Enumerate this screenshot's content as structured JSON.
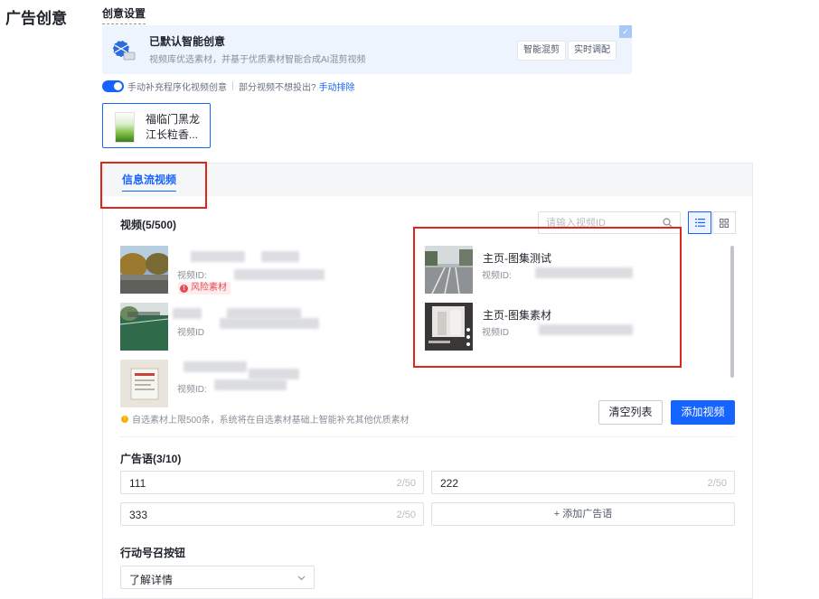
{
  "page": {
    "title": "广告创意",
    "section_title": "创意设置"
  },
  "smart_creative": {
    "title": "已默认智能创意",
    "description": "视频库优选素材，并基于优质素材智能合成AI混剪视频",
    "tags": [
      "智能混剪",
      "实时调配"
    ],
    "check": "✓"
  },
  "toggle_row": {
    "label": "手动补充程序化视频创意",
    "question": "部分视频不想投出?",
    "link": "手动排除"
  },
  "product": {
    "name": "福临门黑龙江长粒香..."
  },
  "tabs": [
    {
      "label": "信息流视频",
      "active": true
    }
  ],
  "videos": {
    "label": "视频(5/500)",
    "search_placeholder": "请输入视频ID",
    "id_prefix_with_colon": "视频ID:",
    "id_prefix_no_colon": "视频ID",
    "risk_label": "风险素材",
    "risk_icon": "!",
    "right_items": [
      {
        "title": "主页-图集测试"
      },
      {
        "title": "主页-图集素材"
      }
    ],
    "tip": "自选素材上限500条，系统将在自选素材基础上智能补充其他优质素材",
    "tip_icon": "!",
    "clear_button": "清空列表",
    "add_button": "添加视频"
  },
  "slogans": {
    "label": "广告语(3/10)",
    "items": [
      {
        "text": "111",
        "count": "2/50"
      },
      {
        "text": "222",
        "count": "2/50"
      },
      {
        "text": "333",
        "count": "2/50"
      }
    ],
    "add_label": "+ 添加广告语"
  },
  "cta": {
    "label": "行动号召按钮",
    "value": "了解详情"
  },
  "colors": {
    "primary": "#1664ff",
    "risk": "#e34d59",
    "highlight_box": "#e0261b"
  }
}
